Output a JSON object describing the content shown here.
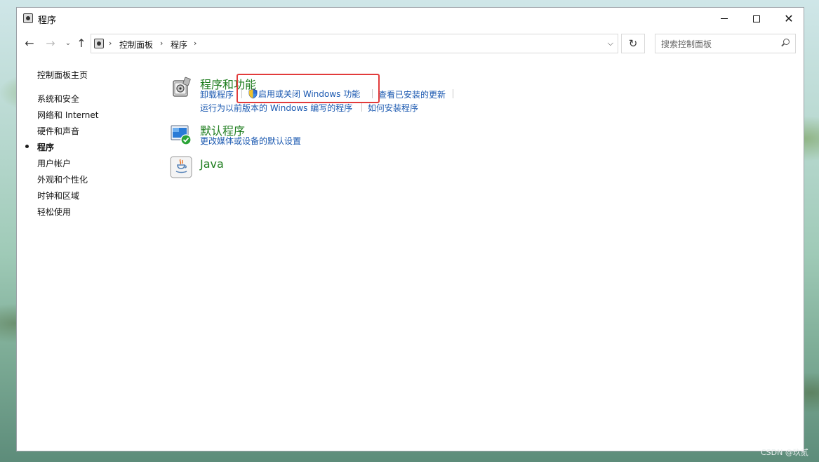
{
  "window": {
    "title": "程序",
    "controls": {
      "minimize": "—",
      "maximize": "☐",
      "close": "✕"
    }
  },
  "nav": {
    "back": "←",
    "forward": "→",
    "recent": "⌄",
    "up": "↑",
    "breadcrumb": [
      "控制面板",
      "程序"
    ],
    "refresh": "↻",
    "search_placeholder": "搜索控制面板"
  },
  "sidebar": {
    "home": "控制面板主页",
    "items": [
      {
        "label": "系统和安全",
        "active": false
      },
      {
        "label": "网络和 Internet",
        "active": false
      },
      {
        "label": "硬件和声音",
        "active": false
      },
      {
        "label": "程序",
        "active": true
      },
      {
        "label": "用户帐户",
        "active": false
      },
      {
        "label": "外观和个性化",
        "active": false
      },
      {
        "label": "时钟和区域",
        "active": false
      },
      {
        "label": "轻松使用",
        "active": false
      }
    ]
  },
  "sections": [
    {
      "icon": "programs-features-icon",
      "title": "程序和功能",
      "links": [
        "卸载程序",
        "启用或关闭 Windows 功能",
        "查看已安装的更新",
        "运行为以前版本的 Windows 编写的程序",
        "如何安装程序"
      ]
    },
    {
      "icon": "default-programs-icon",
      "title": "默认程序",
      "links": [
        "更改媒体或设备的默认设置"
      ]
    },
    {
      "icon": "java-icon",
      "title": "Java",
      "links": []
    }
  ],
  "watermark": "CSDN @玖贰",
  "colors": {
    "title_green": "#1e7d1e",
    "link_blue": "#1a58b0",
    "highlight_red": "#e23b3b"
  }
}
